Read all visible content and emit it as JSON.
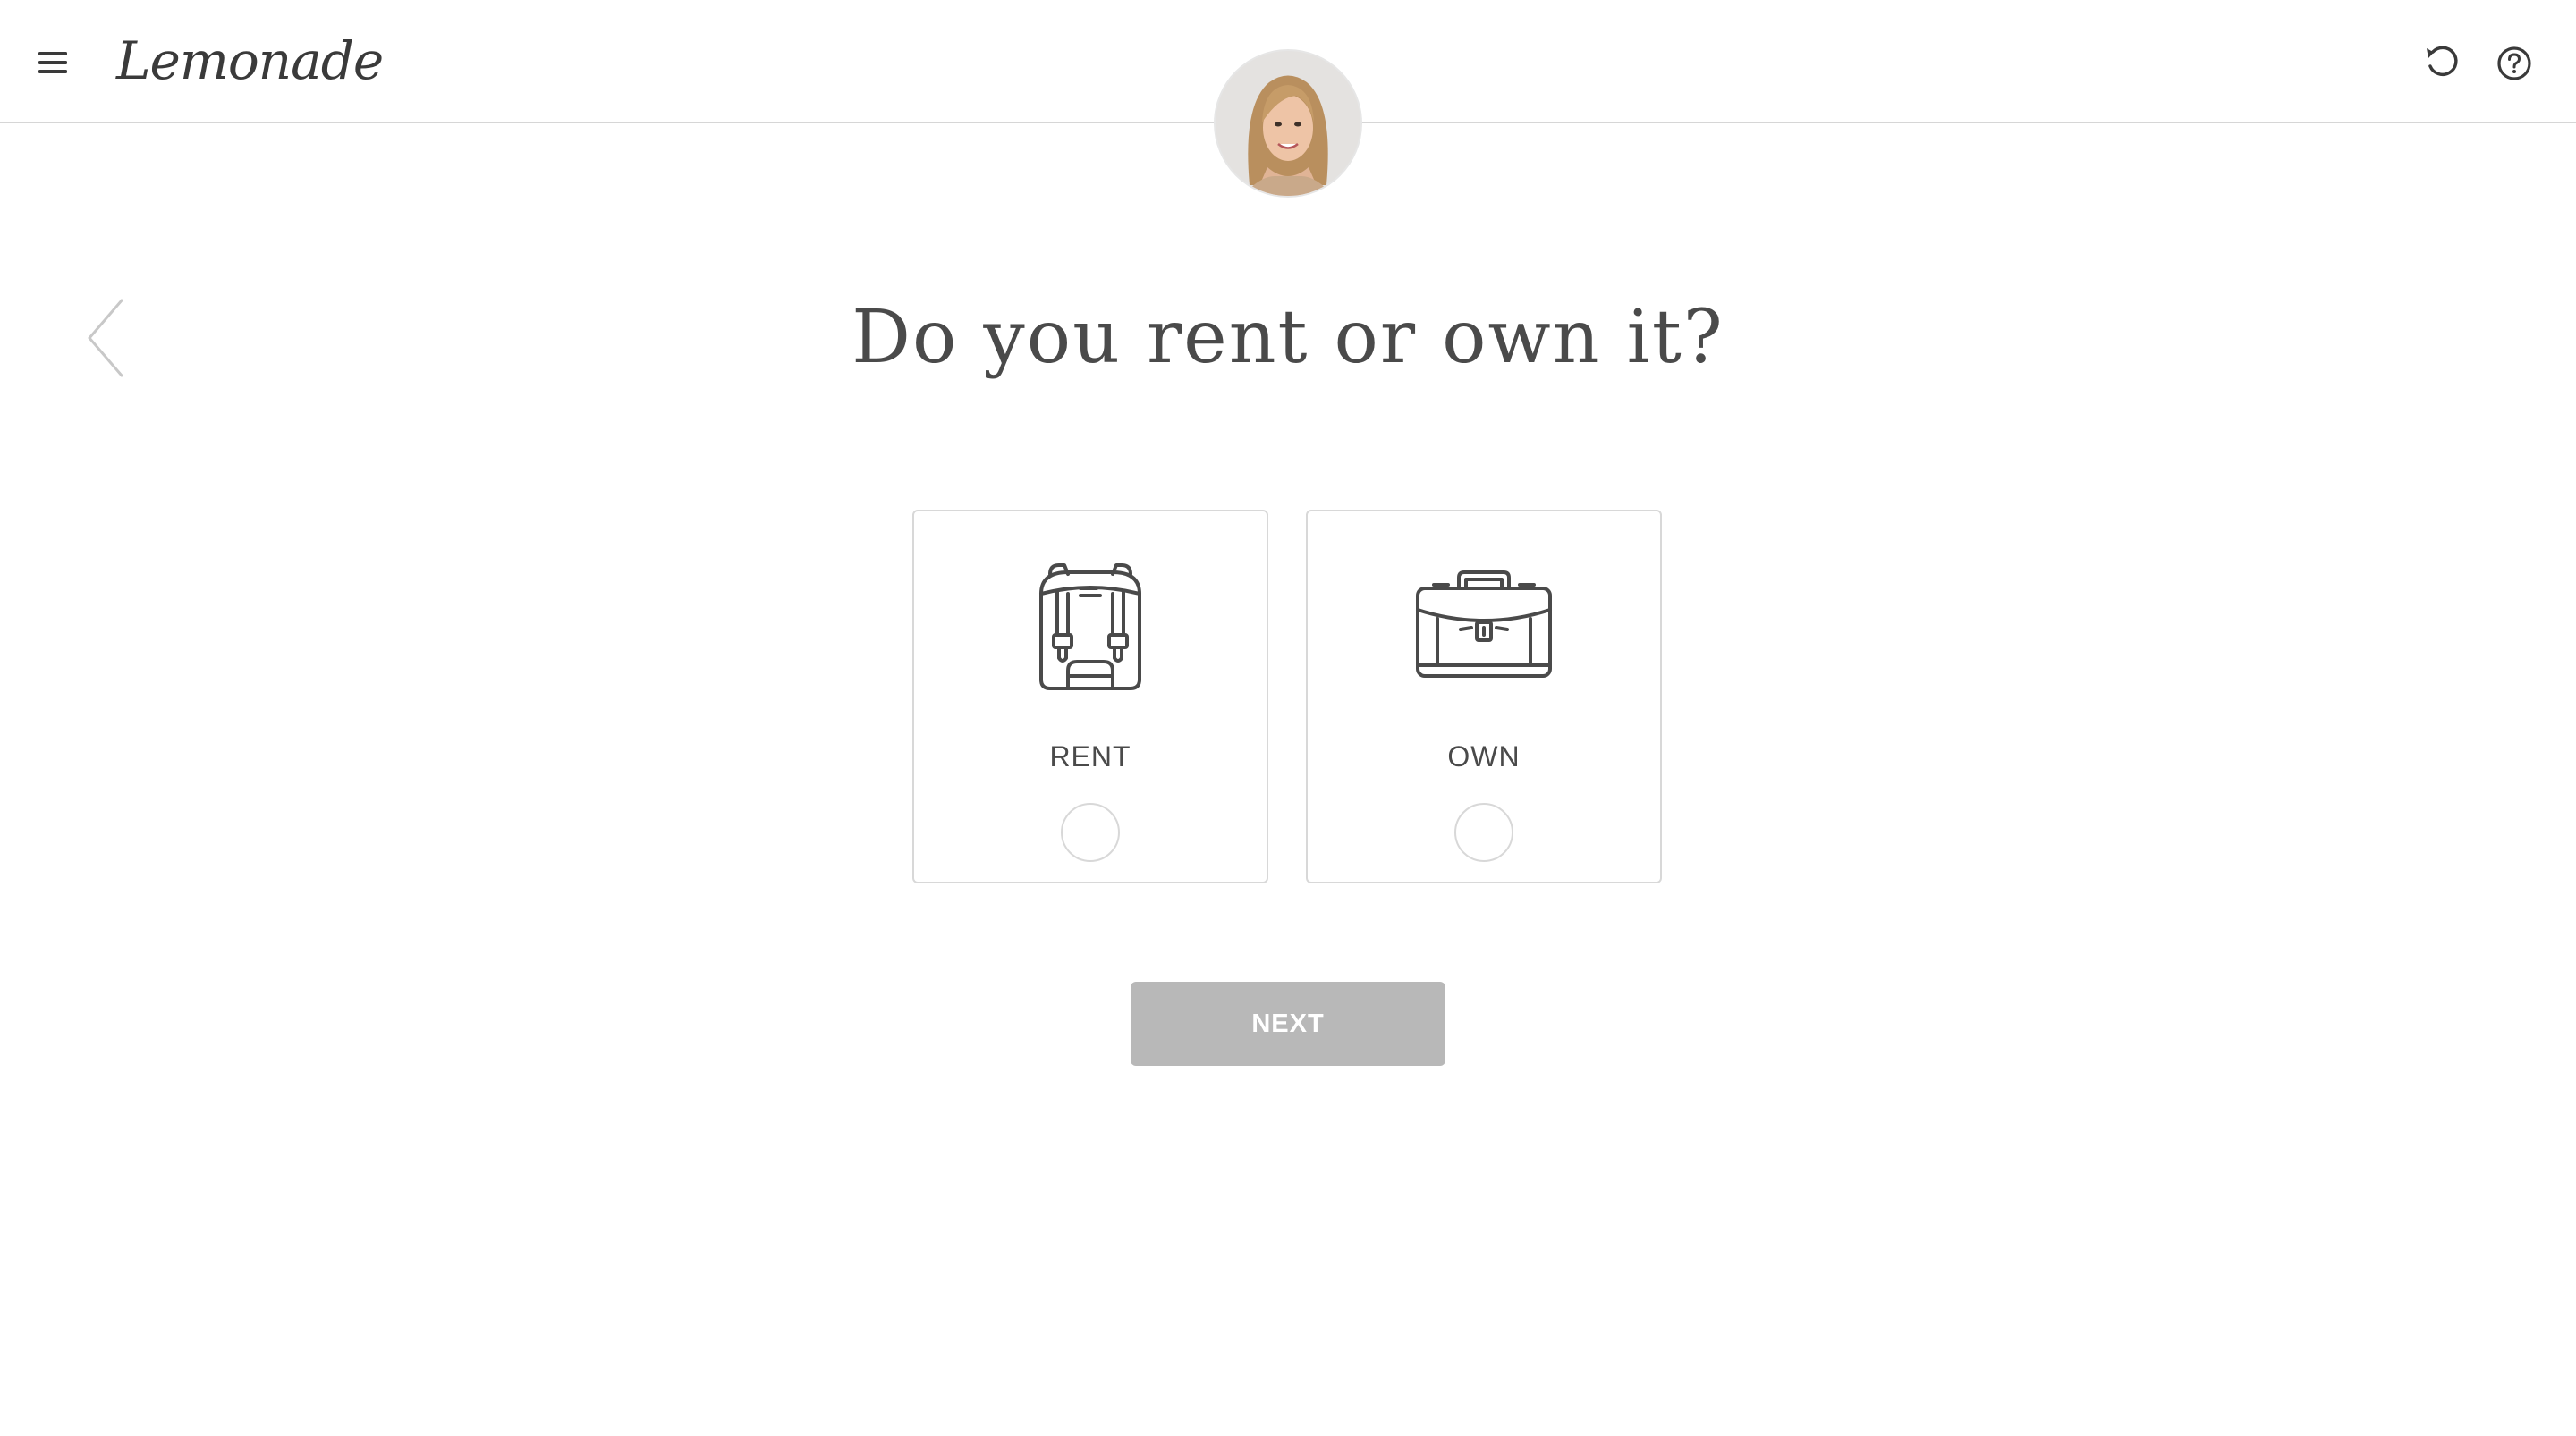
{
  "header": {
    "logo_text": "Lemonade",
    "icons": {
      "menu": "hamburger-menu-icon",
      "restart": "restart-icon",
      "help": "help-icon"
    }
  },
  "avatar": {
    "icon": "assistant-avatar"
  },
  "question": {
    "title": "Do you rent or own it?"
  },
  "options": [
    {
      "label": "RENT",
      "icon": "backpack-icon",
      "selected": false
    },
    {
      "label": "OWN",
      "icon": "briefcase-icon",
      "selected": false
    }
  ],
  "actions": {
    "next_label": "NEXT",
    "next_enabled": false
  },
  "colors": {
    "text": "#4a4a4a",
    "border": "#d8d8d8",
    "button_disabled": "#b8b8b8",
    "button_text": "#ffffff"
  }
}
